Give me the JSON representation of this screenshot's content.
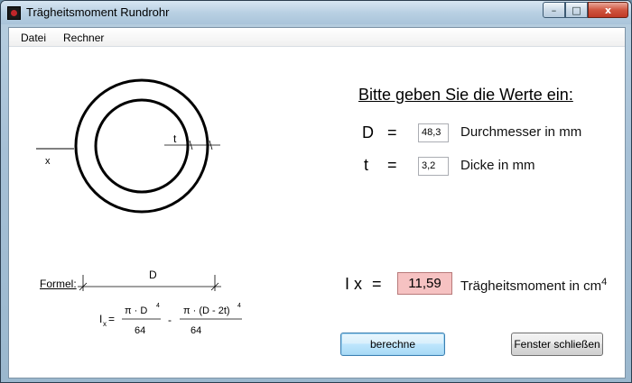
{
  "window": {
    "title": "Trägheitsmoment Rundrohr"
  },
  "titlebar_buttons": {
    "minimize": "–",
    "maximize": "□",
    "close": "x"
  },
  "menu": [
    {
      "label": "Datei"
    },
    {
      "label": "Rechner"
    }
  ],
  "diagram": {
    "axis_label": "x",
    "thickness_label": "t",
    "diameter_label": "D"
  },
  "form": {
    "heading": "Bitte geben Sie die Werte ein:",
    "fields": [
      {
        "symbol": "D",
        "equals": "=",
        "value": "48,3",
        "unit": "Durchmesser in mm"
      },
      {
        "symbol": "t",
        "equals": "=",
        "value": "3,2",
        "unit": "Dicke in mm"
      }
    ]
  },
  "result": {
    "symbol": "I x",
    "equals": "=",
    "value": "11,59",
    "unit": "Trägheitsmoment in cm",
    "unit_exponent": "4",
    "background_color": "#f6c2c2"
  },
  "formula": {
    "label": "Formel:",
    "lhs": "I",
    "lhs_subscript": "x",
    "equals": "=",
    "term1_numerator": "π ·  D",
    "term1_exponent": "4",
    "term1_denominator": "64",
    "minus": "-",
    "term2_numerator": "π ·  (D - 2t)",
    "term2_exponent": "4",
    "term2_denominator": "64"
  },
  "buttons": {
    "calculate": "berechne",
    "close_window": "Fenster schließen"
  }
}
